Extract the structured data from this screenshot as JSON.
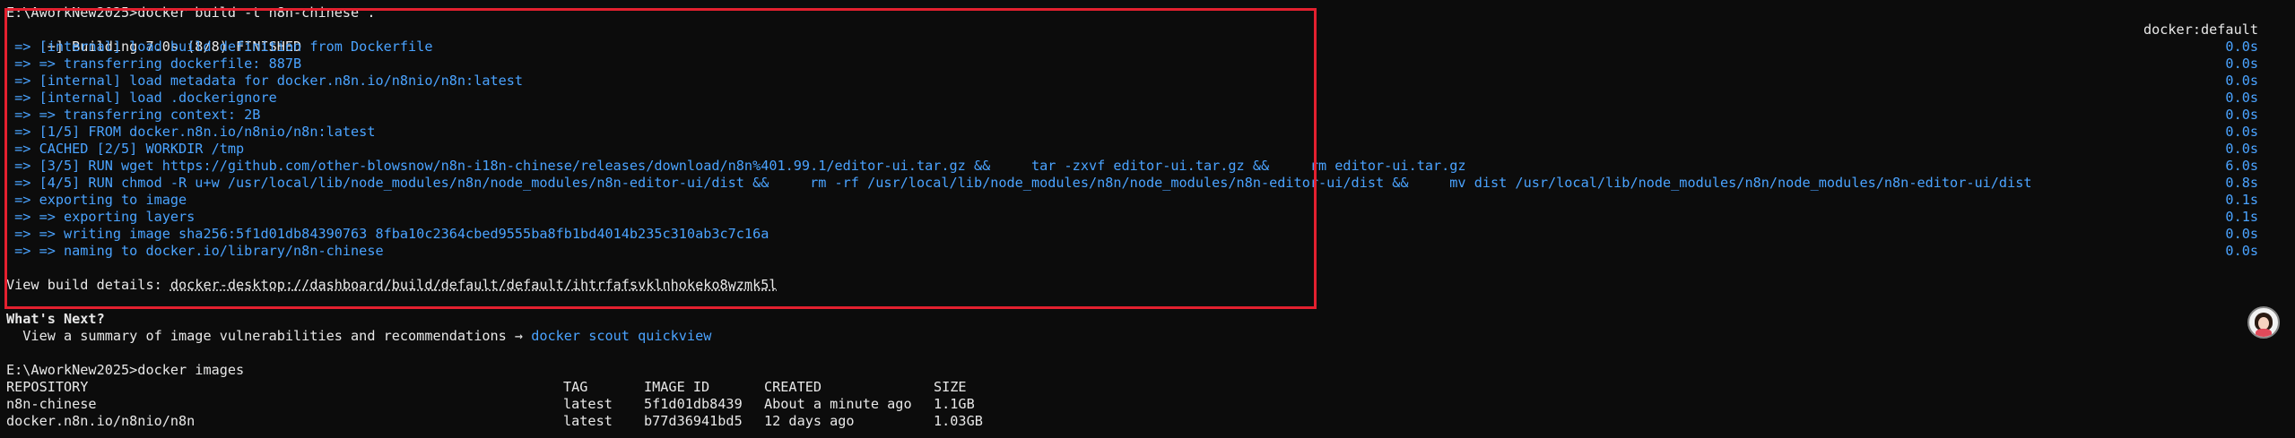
{
  "prompt1": "E:\\AworkNew2025>docker build -t n8n-chinese .",
  "build_header": "[+] Building 7.0s (8/8) FINISHED",
  "builder": "docker:default",
  "steps": [
    {
      "text": " => [internal] load build definition from Dockerfile",
      "time": "0.0s"
    },
    {
      "text": " => => transferring dockerfile: 887B",
      "time": "0.0s"
    },
    {
      "text": " => [internal] load metadata for docker.n8n.io/n8nio/n8n:latest",
      "time": "0.0s"
    },
    {
      "text": " => [internal] load .dockerignore",
      "time": "0.0s"
    },
    {
      "text": " => => transferring context: 2B",
      "time": "0.0s"
    },
    {
      "text": " => [1/5] FROM docker.n8n.io/n8nio/n8n:latest",
      "time": "0.0s"
    },
    {
      "text": " => CACHED [2/5] WORKDIR /tmp",
      "time": "0.0s"
    },
    {
      "text": " => [3/5] RUN wget https://github.com/other-blowsnow/n8n-i18n-chinese/releases/download/n8n%401.99.1/editor-ui.tar.gz &&     tar -zxvf editor-ui.tar.gz &&     rm editor-ui.tar.gz",
      "time": "6.0s"
    },
    {
      "text": " => [4/5] RUN chmod -R u+w /usr/local/lib/node_modules/n8n/node_modules/n8n-editor-ui/dist &&     rm -rf /usr/local/lib/node_modules/n8n/node_modules/n8n-editor-ui/dist &&     mv dist /usr/local/lib/node_modules/n8n/node_modules/n8n-editor-ui/dist",
      "time": "0.8s"
    },
    {
      "text": " => exporting to image",
      "time": "0.1s"
    },
    {
      "text": " => => exporting layers",
      "time": "0.1s"
    },
    {
      "text": " => => writing image sha256:5f1d01db84390763 8fba10c2364cbed9555ba8fb1bd4014b235c310ab3c7c16a",
      "time": "0.0s"
    },
    {
      "text": " => => naming to docker.io/library/n8n-chinese",
      "time": "0.0s"
    }
  ],
  "view_details_label": "View build details: ",
  "view_details_link": "docker-desktop://dashboard/build/default/default/ihtrfafsvklnhokeko8wzmk5l",
  "whats_next": "What's Next?",
  "recommendation": "  View a summary of image vulnerabilities and recommendations → ",
  "scout_command": "docker scout quickview",
  "prompt2": "E:\\AworkNew2025>docker images",
  "images_table": {
    "headers": [
      "REPOSITORY",
      "TAG",
      "IMAGE ID",
      "CREATED",
      "SIZE"
    ],
    "rows": [
      [
        "n8n-chinese",
        "latest",
        "5f1d01db8439",
        "About a minute ago",
        "1.1GB"
      ],
      [
        "docker.n8n.io/n8nio/n8n",
        "latest",
        "b77d36941bd5",
        "12 days ago",
        "1.03GB"
      ]
    ]
  },
  "colors": {
    "background": "#0c0c0c",
    "text": "#e8e8e8",
    "step_blue": "#4aa3ff",
    "highlight_border": "#e3202f"
  }
}
